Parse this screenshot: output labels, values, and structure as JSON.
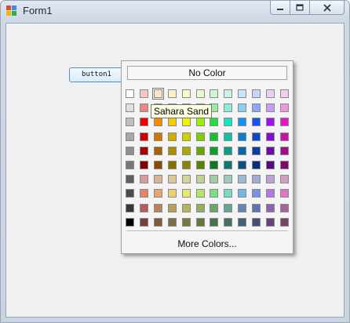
{
  "window": {
    "title": "Form1",
    "icon": "winforms-app-icon"
  },
  "controls": {
    "minimize": "minimize-icon",
    "maximize": "maximize-icon",
    "close": "close-icon"
  },
  "form": {
    "button_label": "button1"
  },
  "picker": {
    "no_color_label": "No Color",
    "more_colors_label": "More Colors...",
    "tooltip": "Sahara Sand",
    "hovered_swatch": {
      "row": 0,
      "col": 2
    },
    "grid": [
      [
        "#ffffff",
        "#f8c6c6",
        "#fce3c3",
        "#fcf0c4",
        "#f9fbc7",
        "#e6fbcb",
        "#cff5d3",
        "#c8f3ec",
        "#c7e6fb",
        "#c9d4fa",
        "#e7cff9",
        "#f7cdee"
      ],
      [
        "#e0e0e0",
        "#f38484",
        "#f6bd8a",
        "#f7e28a",
        "#f4f78a",
        "#c9f58b",
        "#96ee9c",
        "#8ceddc",
        "#8ccdf6",
        "#8ea8f4",
        "#cd9af4",
        "#ef98dc"
      ],
      [
        "#c0c0c0",
        "#ee0000",
        "#f58b00",
        "#f5ca00",
        "#f2f200",
        "#98ef00",
        "#20e040",
        "#14e4c0",
        "#1493f0",
        "#1455f0",
        "#9a14f0",
        "#ea14c4"
      ],
      [
        "#a8a8a8",
        "#cc0000",
        "#d37500",
        "#d3ac00",
        "#d0d000",
        "#82cc00",
        "#18bf36",
        "#10c2a2",
        "#107dcc",
        "#1048cc",
        "#8310cc",
        "#c810a6"
      ],
      [
        "#909090",
        "#a80000",
        "#ac6000",
        "#ac8c00",
        "#aaaa00",
        "#6aa600",
        "#129c2c",
        "#0c9e86",
        "#0c66a6",
        "#0c3aa6",
        "#6a0ca6",
        "#a40c88"
      ],
      [
        "#787878",
        "#840000",
        "#884c00",
        "#886e00",
        "#868600",
        "#548400",
        "#0e7a22",
        "#087c6a",
        "#085082",
        "#082e82",
        "#540882",
        "#80086a"
      ],
      [
        "#606060",
        "#d49c9c",
        "#d8b49a",
        "#d8c89a",
        "#d4d49a",
        "#bcd29a",
        "#a2cca6",
        "#9ecabe",
        "#9cbad2",
        "#a0aed2",
        "#bca2d2",
        "#d0a0c2"
      ],
      [
        "#4c4c4c",
        "#e8806e",
        "#eca46e",
        "#ecd06e",
        "#e8e86e",
        "#b4e46e",
        "#7ede84",
        "#76dcc4",
        "#72b8e4",
        "#7690e4",
        "#b478e4",
        "#de78c6"
      ],
      [
        "#383838",
        "#b45c5c",
        "#b8825c",
        "#b8a05c",
        "#b4b45c",
        "#90b05c",
        "#66a86a",
        "#62a696",
        "#6088b0",
        "#6272b0",
        "#9062b0",
        "#aa6296"
      ],
      [
        "#000000",
        "#7a4040",
        "#7c5a40",
        "#7c6e40",
        "#7a7a40",
        "#647840",
        "#467448",
        "#447266",
        "#425e78",
        "#444e78",
        "#644478",
        "#744466"
      ]
    ]
  }
}
